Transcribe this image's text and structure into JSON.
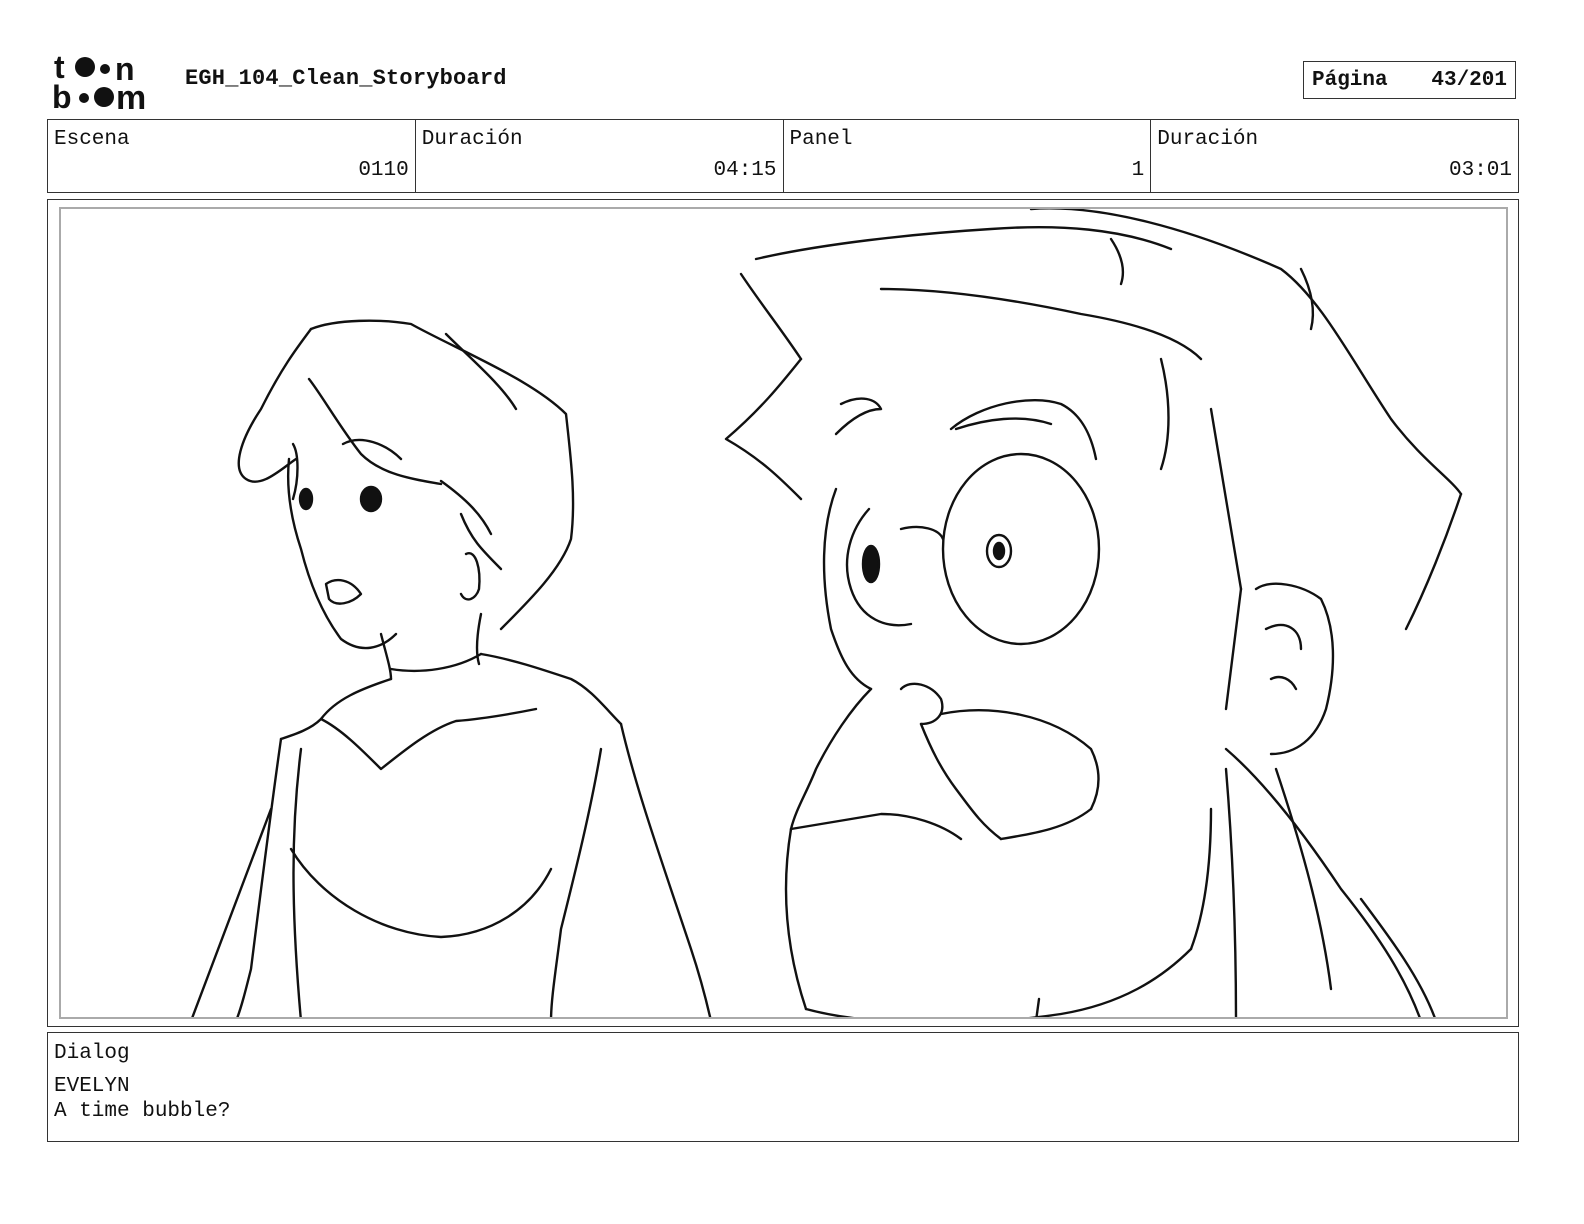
{
  "header": {
    "logo": "toon boom",
    "title": "EGH_104_Clean_Storyboard",
    "page_label": "Página",
    "page_number": "43/201"
  },
  "info": {
    "scene_label": "Escena",
    "scene_value": "0110",
    "scene_duration_label": "Duración",
    "scene_duration_value": "04:15",
    "panel_label": "Panel",
    "panel_value": "1",
    "panel_duration_label": "Duración",
    "panel_duration_value": "03:01"
  },
  "panel": {
    "image": "sketch of a woman with short hair and a bearded man with a mustache"
  },
  "dialog": {
    "label": "Dialog",
    "speaker": "EVELYN",
    "line": "A time bubble?"
  }
}
